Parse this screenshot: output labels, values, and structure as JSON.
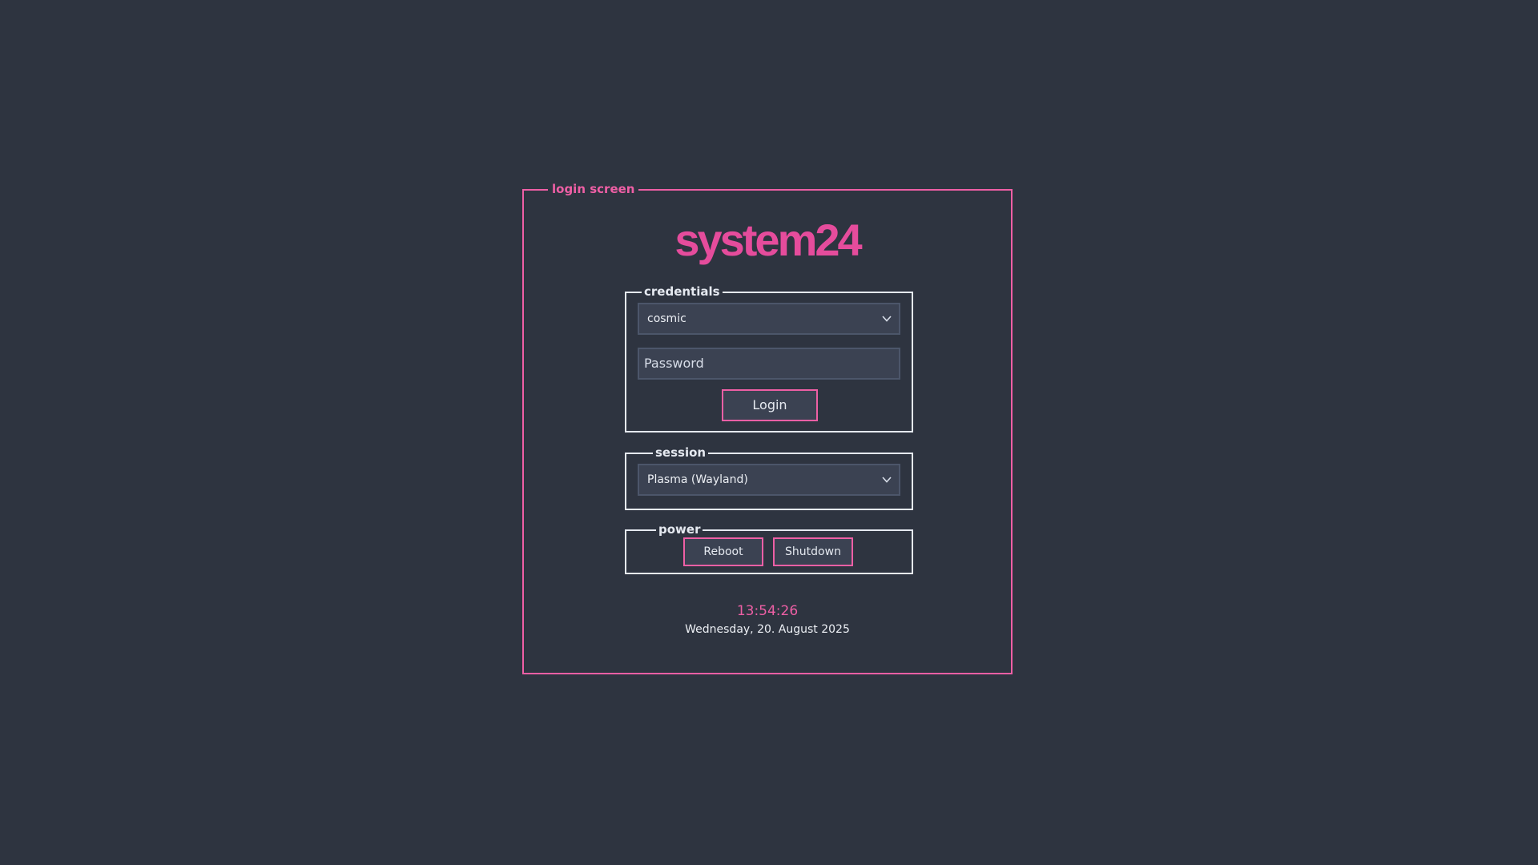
{
  "frame": {
    "title": "login screen"
  },
  "brand": {
    "name": "system24"
  },
  "credentials": {
    "legend": "credentials",
    "user": "cosmic",
    "password_placeholder": "Password",
    "login_label": "Login"
  },
  "session": {
    "legend": "session",
    "selected": "Plasma (Wayland)"
  },
  "power": {
    "legend": "power",
    "reboot_label": "Reboot",
    "shutdown_label": "Shutdown"
  },
  "clock": {
    "time": "13:54:26",
    "date": "Wednesday, 20. August 2025"
  },
  "colors": {
    "background": "#2e3440",
    "accent": "#ee5fa5",
    "border": "#e5e9f0",
    "field": "#3b4252"
  },
  "icons": {
    "select_arrow": "chevron-down-icon"
  }
}
